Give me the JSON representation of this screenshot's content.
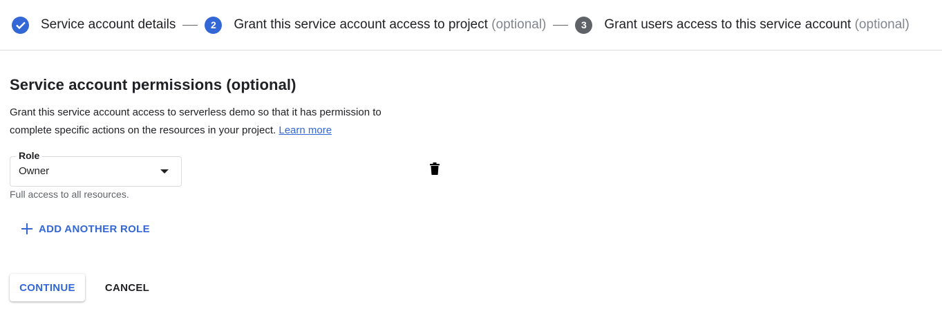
{
  "stepper": {
    "steps": [
      {
        "number": "",
        "label": "Service account details",
        "optional": "",
        "state": "done",
        "icon": "checkmark-icon"
      },
      {
        "number": "2",
        "label": "Grant this service account access to project",
        "optional": "(optional)",
        "state": "active"
      },
      {
        "number": "3",
        "label": "Grant users access to this service account",
        "optional": "(optional)",
        "state": "inactive"
      }
    ]
  },
  "section": {
    "heading": "Service account permissions (optional)",
    "description": "Grant this service account access to serverless demo so that it has permission to complete specific actions on the resources in your project.",
    "learn_more": "Learn more"
  },
  "role": {
    "label": "Role",
    "value": "Owner",
    "hint": "Full access to all resources.",
    "delete_icon": "trash-icon"
  },
  "actions": {
    "add_role": "ADD ANOTHER ROLE",
    "continue": "CONTINUE",
    "cancel": "CANCEL"
  },
  "colors": {
    "accent": "#3367d6",
    "inactive_step": "#5f6368",
    "divider": "#dadce0"
  }
}
